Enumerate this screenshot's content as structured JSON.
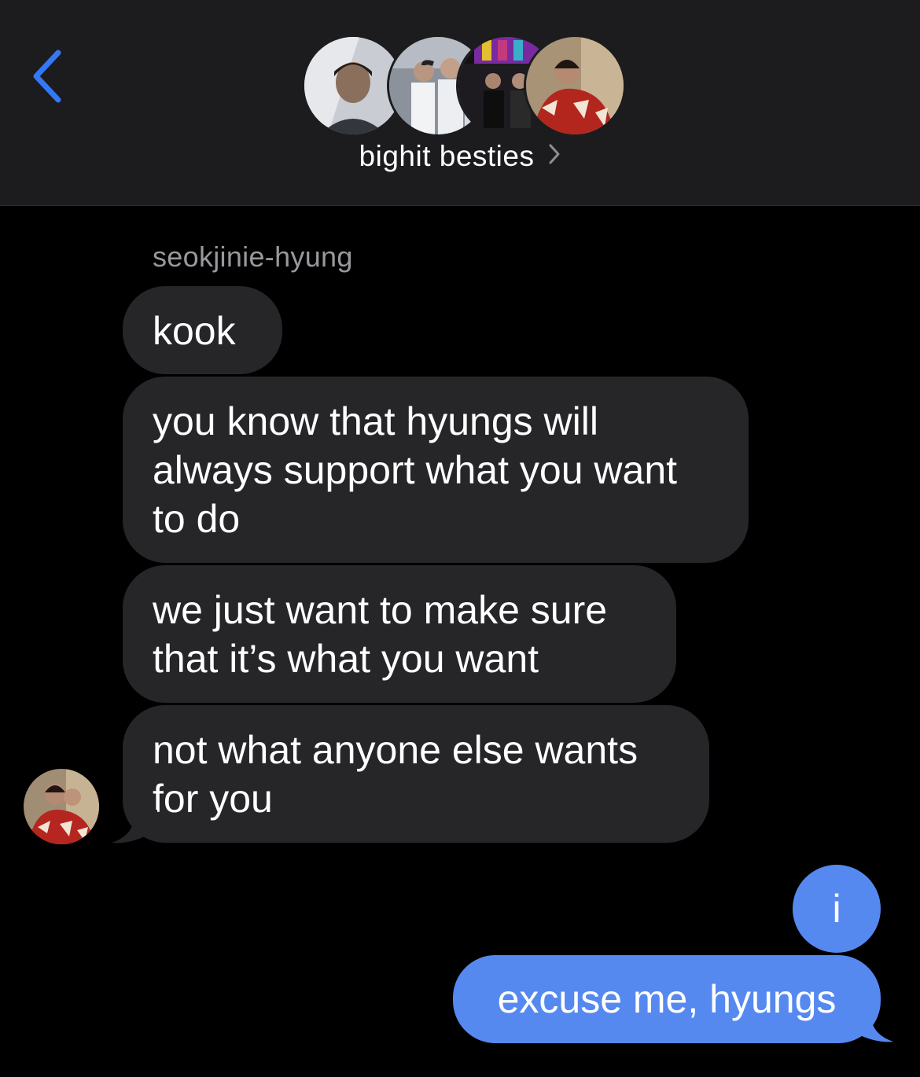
{
  "header": {
    "back_icon": "chevron-left-icon",
    "group_name": "bighit besties",
    "chevron_icon": "chevron-right-icon",
    "accent_color": "#3478f6"
  },
  "conversation": {
    "sender_name": "seokjinie-hyung",
    "incoming": [
      {
        "text": "kook"
      },
      {
        "text": "you know that hyungs will always support what you want to do"
      },
      {
        "text": "we just want to make sure that it’s what you want"
      },
      {
        "text": "not what anyone else wants for you"
      }
    ],
    "outgoing": [
      {
        "text": "i"
      },
      {
        "text": "excuse me, hyungs"
      }
    ],
    "incoming_bubble_color": "#262629",
    "outgoing_bubble_color": "#5689f0"
  }
}
